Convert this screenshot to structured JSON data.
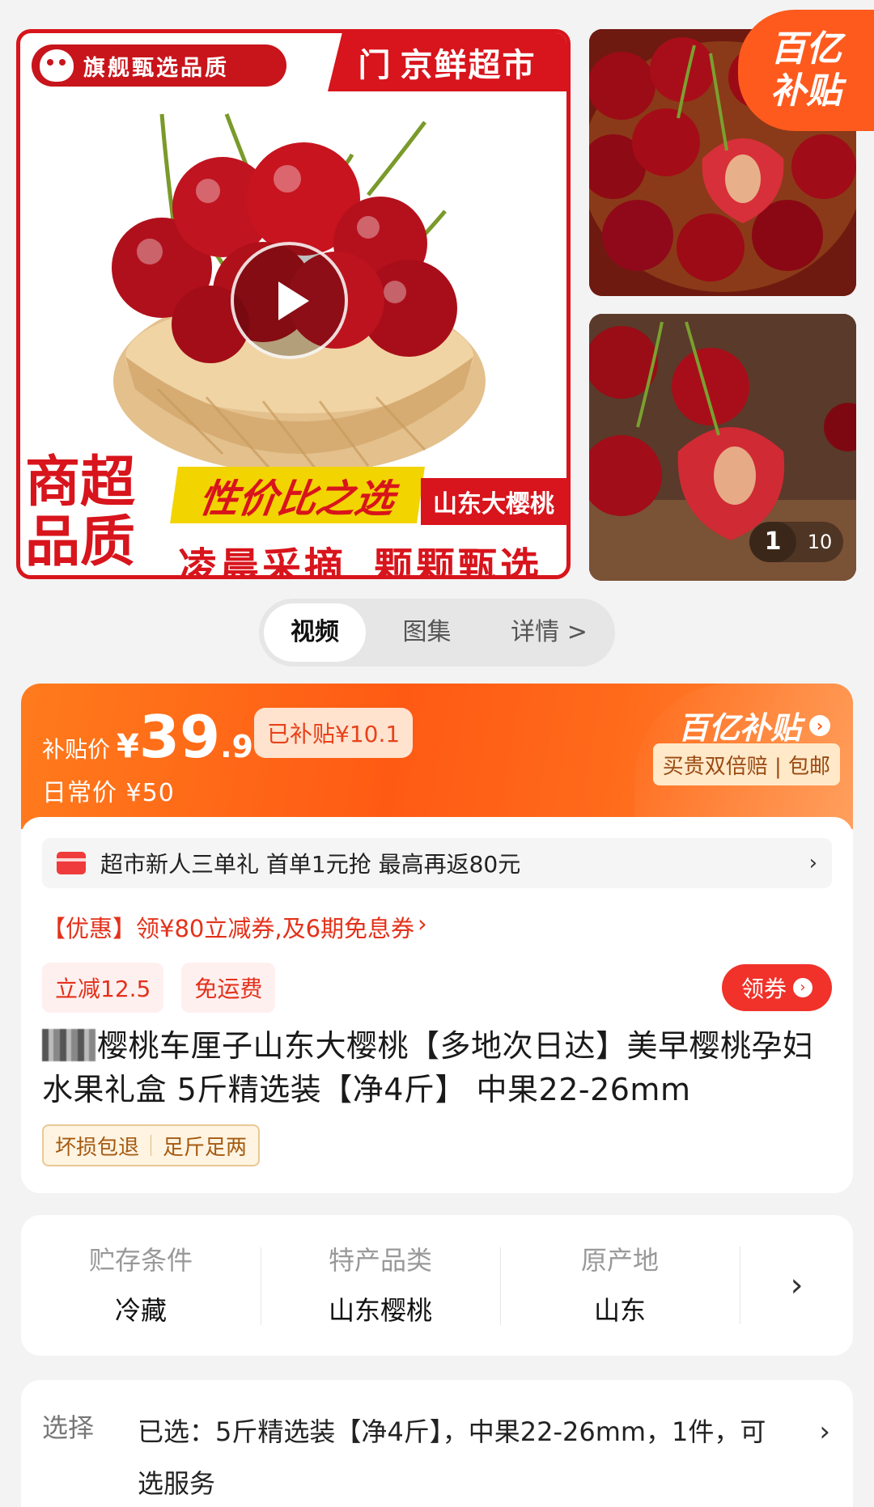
{
  "gallery": {
    "brand_tag": "旗舰甄选品质",
    "store_name": "京鲜超市",
    "store_logo": "门",
    "promo_big": "商超品质",
    "promo_value": "性价比之选",
    "promo_origin": "山东大樱桃",
    "promo_line": [
      "凌晨采摘",
      "颗颗甄选"
    ],
    "subsidy_badge": [
      "百亿",
      "补贴"
    ],
    "counter_current": "1",
    "counter_total": "10",
    "play_icon": "play-icon"
  },
  "media_tabs": [
    {
      "label": "视频",
      "active": true
    },
    {
      "label": "图集",
      "active": false
    },
    {
      "label": "详情 >",
      "active": false
    }
  ],
  "price": {
    "label": "补贴价",
    "currency": "¥",
    "integer": "39",
    "decimal": ".9",
    "subsidy_chip": "已补贴¥10.1",
    "regular": "日常价 ¥50",
    "program_name": "百亿补贴",
    "program_arrow": "›",
    "program_sub": "买贵双倍赔 | 包邮",
    "banner_colors": [
      "#ff7b1c",
      "#ff5a14"
    ]
  },
  "promo": {
    "strip_text": "超市新人三单礼 首单1元抢 最高再返80元",
    "strip_chevron": "›",
    "coupon_line": "【优惠】领¥80立减券,及6期免息券",
    "coupon_chevron": "›",
    "chips": [
      "立减12.5",
      "免运费"
    ],
    "claim_button": "领券",
    "claim_arrow": "›"
  },
  "product": {
    "title": "樱桃车厘子山东大樱桃【多地次日达】美早樱桃孕妇水果礼盒 5斤精选装【净4斤】 中果22-26mm",
    "assurances": [
      "坏损包退",
      "足斤足两"
    ]
  },
  "specs": [
    {
      "label": "贮存条件",
      "value": "冷藏"
    },
    {
      "label": "特产品类",
      "value": "山东樱桃"
    },
    {
      "label": "原产地",
      "value": "山东"
    }
  ],
  "specs_more": "›",
  "selection": {
    "label": "选择",
    "value": "已选：5斤精选装【净4斤】，中果22-26mm，1件，可选服务",
    "chevron": "›"
  }
}
